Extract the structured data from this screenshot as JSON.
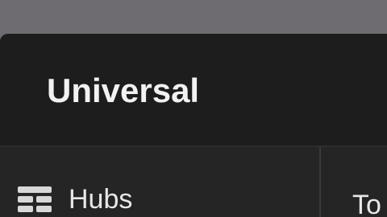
{
  "app": {
    "title": "Universal"
  },
  "sidebar": {
    "items": [
      {
        "label": "Hubs",
        "icon": "hubs-grid-icon"
      }
    ]
  },
  "main": {
    "partial_label": "To"
  },
  "colors": {
    "desktop_background": "#6f6c71",
    "window_background": "#1d1d1e",
    "panel_background": "#252526",
    "text_primary": "#f2f2f2",
    "divider": "#3a3a3c"
  }
}
